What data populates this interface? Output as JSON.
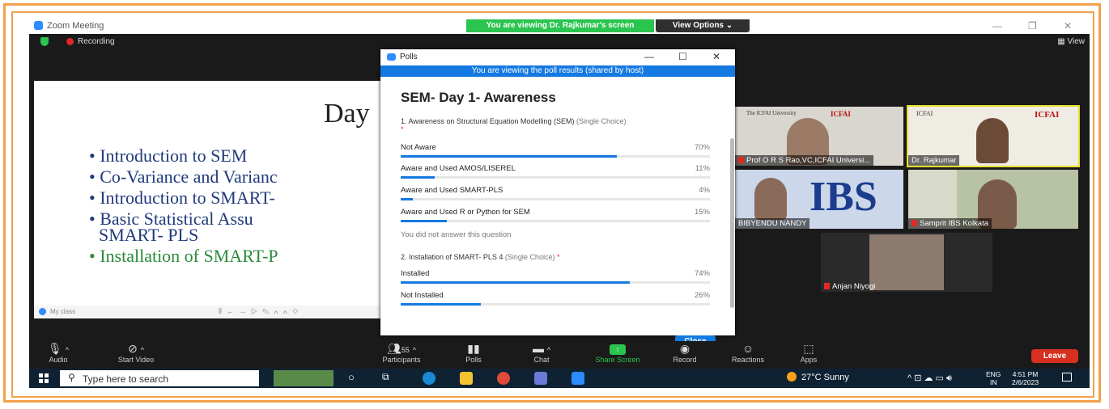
{
  "window": {
    "app_title": "Zoom Meeting",
    "viewing_banner": "You are viewing Dr. Rajkumar's screen",
    "view_options": "View Options ⌄"
  },
  "meeting_bar": {
    "recording": "Recording",
    "view": "View"
  },
  "slide": {
    "title": "Day",
    "bullets": [
      "• Introduction to SEM",
      "• Co-Variance and Varianc",
      "• Introduction to SMART-",
      "• Basic   Statistical   Assu",
      "SMART- PLS",
      "• Installation of SMART-P"
    ],
    "toolbar_label": "My class"
  },
  "poll": {
    "window_title": "Polls",
    "banner": "You are viewing the poll results (shared by host)",
    "title": "SEM- Day 1- Awareness",
    "questions": [
      {
        "text": "1. Awareness on Structural Equation Modelling (SEM)",
        "type": "(Single Choice)",
        "required": "*",
        "options": [
          {
            "label": "Not Aware",
            "pct": "70%",
            "value": 0.7
          },
          {
            "label": "Aware and Used AMOS/LISEREL",
            "pct": "11%",
            "value": 0.11
          },
          {
            "label": "Aware and Used SMART-PLS",
            "pct": "4%",
            "value": 0.04
          },
          {
            "label": "Aware and Used R or Python for SEM",
            "pct": "15%",
            "value": 0.15
          }
        ],
        "note": "You did not answer this question"
      },
      {
        "text": "2. Installation of SMART- PLS 4",
        "type": "(Single Choice)",
        "required": "*",
        "options": [
          {
            "label": "Installed",
            "pct": "74%",
            "value": 0.74
          },
          {
            "label": "Not Installed",
            "pct": "26%",
            "value": 0.26
          }
        ]
      }
    ],
    "close": "Close"
  },
  "participants": [
    {
      "name": "Prof O R S Rao,VC,ICFAI Universi...",
      "muted": true
    },
    {
      "name": "Dr. Rajkumar",
      "muted": false
    },
    {
      "name": "BIBYENDU NANDY",
      "muted": false
    },
    {
      "name": "Samprit IBS Kolkata",
      "muted": true
    },
    {
      "name": "Anjan Niyogi",
      "muted": true
    }
  ],
  "controls": {
    "audio": "Audio",
    "start_video": "Start Video",
    "participants": "Participants",
    "participants_count": "55",
    "polls": "Polls",
    "chat": "Chat",
    "share_screen": "Share Screen",
    "record": "Record",
    "reactions": "Reactions",
    "apps": "Apps",
    "leave": "Leave"
  },
  "taskbar": {
    "search_placeholder": "Type here to search",
    "weather": "27°C  Sunny",
    "lang1": "ENG",
    "lang2": "IN",
    "time": "4:51 PM",
    "date": "2/6/2023"
  },
  "colors": {
    "accent": "#1479e0",
    "zoom_green": "#2ac44f",
    "leave_red": "#d83020",
    "frame_orange": "#f2a14a"
  }
}
